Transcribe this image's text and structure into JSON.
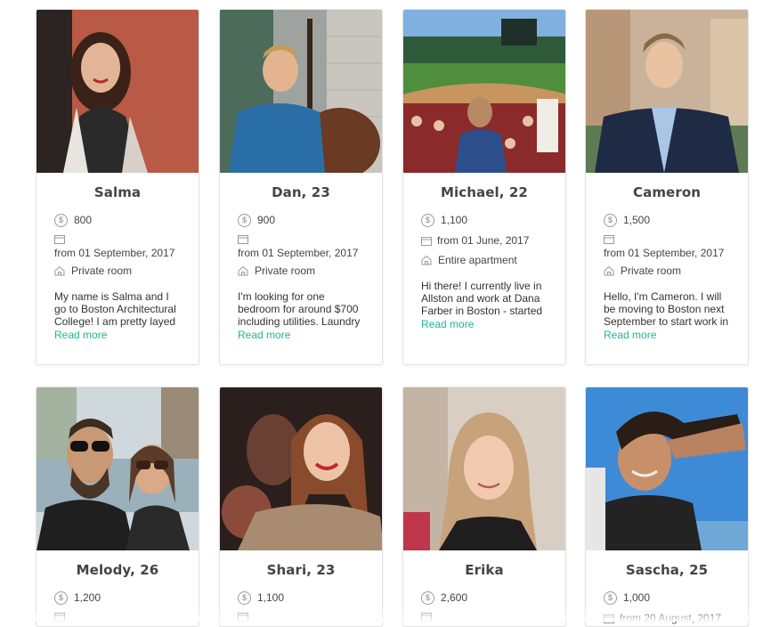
{
  "listings": [
    {
      "name": "Salma",
      "price": "800",
      "date": "from 01 September, 2017",
      "type": "Private room",
      "description": "My name is Salma and I go to Boston Architectural College! I am pretty layed",
      "read_more": "Read more"
    },
    {
      "name": "Dan, 23",
      "price": "900",
      "date": "from 01 September, 2017",
      "type": "Private room",
      "description": "I'm looking for one bedroom for around $700 including utilities. Laundry",
      "read_more": "Read more"
    },
    {
      "name": "Michael, 22",
      "price": "1,100",
      "date": "from 01 June, 2017",
      "type": "Entire apartment",
      "description": "Hi there! I currently live in Allston and work at Dana Farber in Boston - started",
      "read_more": "Read more"
    },
    {
      "name": "Cameron",
      "price": "1,500",
      "date": "from 01 September, 2017",
      "type": "Private room",
      "description": "Hello, I'm Cameron. I will be moving to Boston next September to start work in",
      "read_more": "Read more"
    },
    {
      "name": "Melody, 26",
      "price": "1,200"
    },
    {
      "name": "Shari, 23",
      "price": "1,100"
    },
    {
      "name": "Erika",
      "price": "2,600"
    },
    {
      "name": "Sascha, 25",
      "price": "1,000",
      "date": "from 20 August, 2017"
    }
  ],
  "icons": {
    "price": "dollar-circle-icon",
    "date": "calendar-icon",
    "type": "home-icon"
  },
  "colors": {
    "link": "#1fb59b"
  }
}
